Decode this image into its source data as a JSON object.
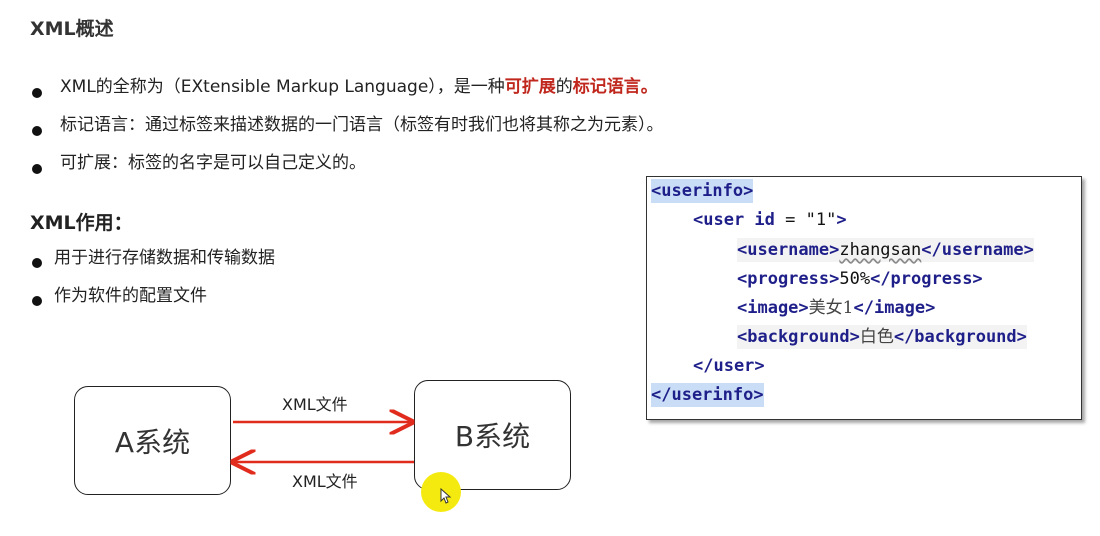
{
  "title": "XML概述",
  "intro": [
    {
      "parts": [
        {
          "text": "XML的全称为（EXtensible Markup Language），是一种",
          "emph": false
        },
        {
          "text": "可扩展",
          "emph": true
        },
        {
          "text": "的",
          "emph": false
        },
        {
          "text": "标记语言。",
          "emph": true
        }
      ]
    },
    {
      "parts": [
        {
          "text": "标记语言：通过标签来描述数据的一门语言（标签有时我们也将其称之为元素）。",
          "emph": false
        }
      ]
    },
    {
      "parts": [
        {
          "text": "可扩展：标签的名字是可以自己定义的。",
          "emph": false
        }
      ]
    }
  ],
  "uses_title": "XML作用：",
  "uses": [
    "用于进行存储数据和传输数据",
    "作为软件的配置文件"
  ],
  "diagram": {
    "system_a": "A系统",
    "system_b": "B系统",
    "arrow_top_label": "XML文件",
    "arrow_bottom_label": "XML文件",
    "arrow_color": "#e02b1d"
  },
  "code": {
    "root_open": "<userinfo>",
    "user_open_start": "<user ",
    "user_attr": "id",
    "user_eq": " = ",
    "user_val": "\"1\"",
    "user_open_end": ">",
    "username_open": "<username>",
    "username_value": "zhangsan",
    "username_close": "</username>",
    "progress_open": "<progress>",
    "progress_value": "50%",
    "progress_close": "</progress>",
    "image_open": "<image>",
    "image_value": "美女1",
    "image_close": "</image>",
    "background_open": "<background>",
    "background_value": "白色",
    "background_close": "</background>",
    "user_close": "</user>",
    "root_close": "</userinfo>"
  },
  "colors": {
    "emphasis": "#c0271d",
    "tag": "#1f1f8a",
    "selection": "#cde3f8",
    "cursor_halo": "#f5ea10"
  }
}
